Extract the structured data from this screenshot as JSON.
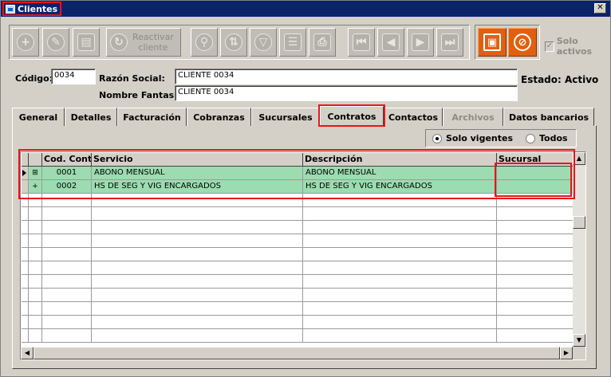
{
  "window": {
    "title": "Clientes",
    "close_glyph": "✕"
  },
  "toolbar": {
    "reactivar_label_1": "Reactivar",
    "reactivar_label_2": "cliente",
    "buttons": [
      "plus-icon",
      "pencil-icon",
      "delete-doc-icon",
      "reactivar-icon",
      "search-icon",
      "sort-icon",
      "filter-icon",
      "report-icon",
      "print-icon",
      "first-icon",
      "previous-icon",
      "next-icon",
      "last-icon"
    ],
    "save_icon": "save-icon",
    "cancel_icon": "cancel-icon",
    "solo_activos_label": "Solo activos",
    "solo_activos_checked": true
  },
  "form": {
    "codigo_label": "Código:",
    "codigo_value": "0034",
    "razon_social_label": "Razón Social:",
    "razon_social_value": "CLIENTE 0034",
    "nombre_fantasia_label": "Nombre Fantasía:",
    "nombre_fantasia_value": "CLIENTE 0034",
    "estado_text": "Estado: Activo"
  },
  "tabs": [
    {
      "label": "General",
      "active": false,
      "enabled": true
    },
    {
      "label": "Detalles",
      "active": false,
      "enabled": true
    },
    {
      "label": "Facturación",
      "active": false,
      "enabled": true
    },
    {
      "label": "Cobranzas",
      "active": false,
      "enabled": true
    },
    {
      "label": "Sucursales",
      "active": false,
      "enabled": true
    },
    {
      "label": "Contratos",
      "active": true,
      "enabled": true
    },
    {
      "label": "Contactos",
      "active": false,
      "enabled": true
    },
    {
      "label": "Archivos",
      "active": false,
      "enabled": false
    },
    {
      "label": "Datos bancarios",
      "active": false,
      "enabled": true
    }
  ],
  "filter": {
    "solo_vigentes_label": "Solo vigentes",
    "todos_label": "Todos",
    "selected": "solo_vigentes"
  },
  "grid": {
    "columns": [
      "Cod. Cont.",
      "Servicio",
      "Descripción",
      "Sucursal"
    ],
    "rows": [
      {
        "expander": "⊞",
        "cod": "0001",
        "servicio": "ABONO MENSUAL",
        "descripcion": "ABONO MENSUAL",
        "sucursal": ""
      },
      {
        "expander": "+",
        "cod": "0002",
        "servicio": "HS DE SEG Y VIG ENCARGADOS",
        "descripcion": "HS DE SEG Y VIG ENCARGADOS",
        "sucursal": ""
      }
    ],
    "row_highlight_color": "#9cdcb0"
  },
  "colors": {
    "title_bar": "#0a246a",
    "annotation_red": "#e8141b",
    "accent_orange": "#e06010"
  }
}
